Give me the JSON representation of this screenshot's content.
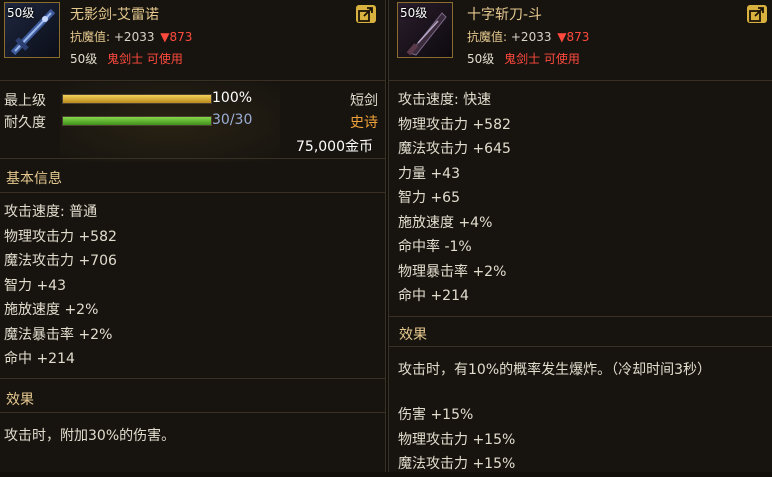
{
  "left": {
    "level_tag": "50级",
    "name": "无影剑-艾雷诺",
    "resist_label": "抗魔值:",
    "resist_value": "+2033",
    "resist_delta": "▼873",
    "req_level": "50级",
    "req_class": "鬼剑士 可使用",
    "grade_label": "最上级",
    "grade_text": "100%",
    "grade_percent": 100,
    "durability_label": "耐久度",
    "durability_text": "30/30",
    "durability_percent": 100,
    "weapon_type": "短剑",
    "rarity": "史诗",
    "price": "75,000金币",
    "base_info_title": "基本信息",
    "stats": [
      "攻击速度: 普通",
      "物理攻击力 +582",
      "魔法攻击力 +706",
      "智力 +43",
      "施放速度 +2%",
      "魔法暴击率 +2%",
      "命中 +214"
    ],
    "effect_title": "效果",
    "effect_text": "攻击时，附加30%的伤害。"
  },
  "right": {
    "level_tag": "50级",
    "name": "十字斩刀-斗",
    "resist_label": "抗魔值:",
    "resist_value": "+2033",
    "resist_delta": "▼873",
    "req_level": "50级",
    "req_class": "鬼剑士 可使用",
    "stats": [
      "攻击速度: 快速",
      "物理攻击力 +582",
      "魔法攻击力 +645",
      "力量 +43",
      "智力 +65",
      "施放速度 +4%",
      "命中率 -1%",
      "物理暴击率 +2%",
      "命中 +214"
    ],
    "effect_title": "效果",
    "effect_text": "攻击时，有10%的概率发生爆炸。（冷却时间3秒）",
    "effect_bonuses": [
      "伤害 +15%",
      "物理攻击力 +15%",
      "魔法攻击力 +15%"
    ]
  },
  "colors": {
    "name_gold": "#e6c98f",
    "negative_red": "#ff4a3d",
    "rarity_orange": "#f2a23a",
    "grade_bar": "#d9a52a",
    "durability_bar": "#5fb52f"
  },
  "icons": [
    "sword-item-icon",
    "blade-item-icon",
    "share-icon"
  ]
}
